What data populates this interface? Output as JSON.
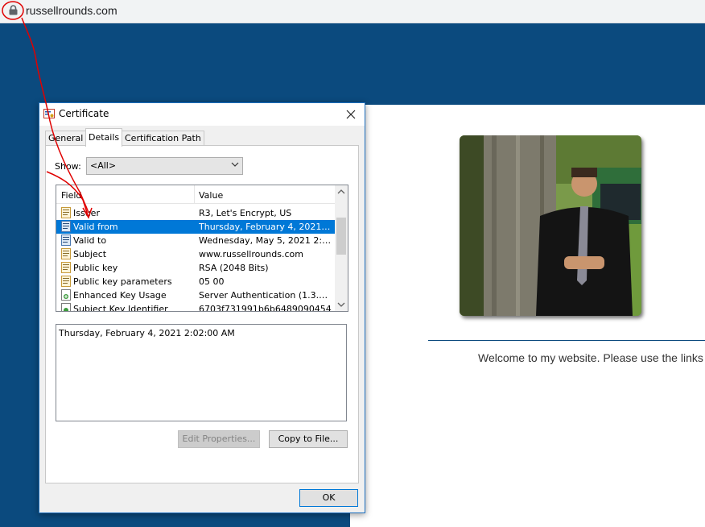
{
  "browser": {
    "url": "russellrounds.com"
  },
  "website": {
    "welcome_text": "Welcome to my website. Please use the links"
  },
  "dialog": {
    "title": "Certificate",
    "tabs": [
      "General",
      "Details",
      "Certification Path"
    ],
    "show_label": "Show:",
    "show_value": "<All>",
    "columns": {
      "field": "Field",
      "value": "Value"
    },
    "rows": [
      {
        "field": "Issuer",
        "value": "R3, Let's Encrypt, US"
      },
      {
        "field": "Valid from",
        "value": "Thursday, February 4, 2021 2..."
      },
      {
        "field": "Valid to",
        "value": "Wednesday, May 5, 2021 2:0..."
      },
      {
        "field": "Subject",
        "value": "www.russellrounds.com"
      },
      {
        "field": "Public key",
        "value": "RSA (2048 Bits)"
      },
      {
        "field": "Public key parameters",
        "value": "05 00"
      },
      {
        "field": "Enhanced Key Usage",
        "value": "Server Authentication (1.3.6...."
      },
      {
        "field": "Subject Key Identifier",
        "value": "6703f731991b6b6489090454"
      }
    ],
    "selected_row": 1,
    "detail_value": "Thursday, February 4, 2021 2:02:00 AM",
    "edit_properties": "Edit Properties...",
    "copy_to_file": "Copy to File...",
    "ok": "OK"
  },
  "colors": {
    "page_bg": "#0b4a7e",
    "selection": "#0078d7",
    "annotation": "#e00000"
  }
}
